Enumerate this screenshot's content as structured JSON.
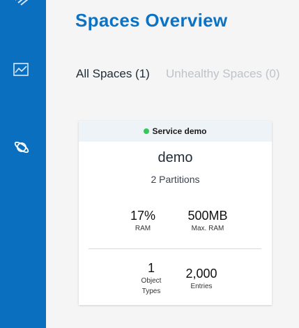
{
  "header": {
    "title": "Spaces Overview"
  },
  "sidebar": {
    "items": [
      {
        "icon": "chart-icon"
      },
      {
        "icon": "planet-icon"
      }
    ]
  },
  "tabs": {
    "all": "All Spaces (1)",
    "unhealthy": "Unhealthy Spaces (0)"
  },
  "card": {
    "service_label": "Service demo",
    "status_color": "#34c759",
    "name": "demo",
    "partitions": "2 Partitions",
    "ram": {
      "value": "17%",
      "label": "RAM"
    },
    "max_ram": {
      "value": "500MB",
      "label": "Max. RAM"
    },
    "object_types": {
      "value": "1",
      "label_line1": "Object",
      "label_line2": "Types"
    },
    "entries": {
      "value": "2,000",
      "label": "Entries"
    }
  },
  "colors": {
    "sidebar": "#0b6fc0",
    "title": "#0b73c6",
    "card_header": "#eef3f8"
  }
}
